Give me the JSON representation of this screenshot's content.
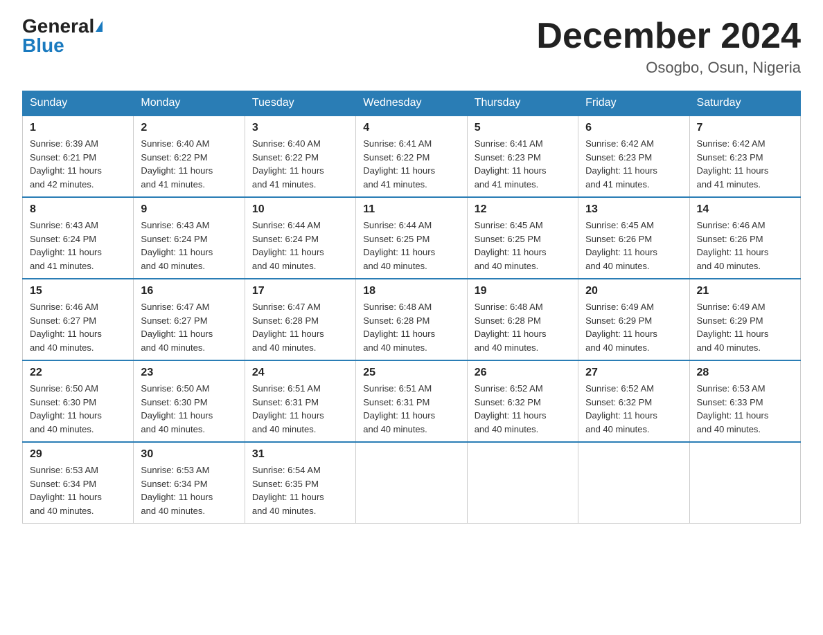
{
  "header": {
    "logo_general": "General",
    "logo_blue": "Blue",
    "month_title": "December 2024",
    "location": "Osogbo, Osun, Nigeria"
  },
  "columns": [
    "Sunday",
    "Monday",
    "Tuesday",
    "Wednesday",
    "Thursday",
    "Friday",
    "Saturday"
  ],
  "weeks": [
    [
      {
        "day": "1",
        "sunrise": "6:39 AM",
        "sunset": "6:21 PM",
        "daylight": "11 hours and 42 minutes."
      },
      {
        "day": "2",
        "sunrise": "6:40 AM",
        "sunset": "6:22 PM",
        "daylight": "11 hours and 41 minutes."
      },
      {
        "day": "3",
        "sunrise": "6:40 AM",
        "sunset": "6:22 PM",
        "daylight": "11 hours and 41 minutes."
      },
      {
        "day": "4",
        "sunrise": "6:41 AM",
        "sunset": "6:22 PM",
        "daylight": "11 hours and 41 minutes."
      },
      {
        "day": "5",
        "sunrise": "6:41 AM",
        "sunset": "6:23 PM",
        "daylight": "11 hours and 41 minutes."
      },
      {
        "day": "6",
        "sunrise": "6:42 AM",
        "sunset": "6:23 PM",
        "daylight": "11 hours and 41 minutes."
      },
      {
        "day": "7",
        "sunrise": "6:42 AM",
        "sunset": "6:23 PM",
        "daylight": "11 hours and 41 minutes."
      }
    ],
    [
      {
        "day": "8",
        "sunrise": "6:43 AM",
        "sunset": "6:24 PM",
        "daylight": "11 hours and 41 minutes."
      },
      {
        "day": "9",
        "sunrise": "6:43 AM",
        "sunset": "6:24 PM",
        "daylight": "11 hours and 40 minutes."
      },
      {
        "day": "10",
        "sunrise": "6:44 AM",
        "sunset": "6:24 PM",
        "daylight": "11 hours and 40 minutes."
      },
      {
        "day": "11",
        "sunrise": "6:44 AM",
        "sunset": "6:25 PM",
        "daylight": "11 hours and 40 minutes."
      },
      {
        "day": "12",
        "sunrise": "6:45 AM",
        "sunset": "6:25 PM",
        "daylight": "11 hours and 40 minutes."
      },
      {
        "day": "13",
        "sunrise": "6:45 AM",
        "sunset": "6:26 PM",
        "daylight": "11 hours and 40 minutes."
      },
      {
        "day": "14",
        "sunrise": "6:46 AM",
        "sunset": "6:26 PM",
        "daylight": "11 hours and 40 minutes."
      }
    ],
    [
      {
        "day": "15",
        "sunrise": "6:46 AM",
        "sunset": "6:27 PM",
        "daylight": "11 hours and 40 minutes."
      },
      {
        "day": "16",
        "sunrise": "6:47 AM",
        "sunset": "6:27 PM",
        "daylight": "11 hours and 40 minutes."
      },
      {
        "day": "17",
        "sunrise": "6:47 AM",
        "sunset": "6:28 PM",
        "daylight": "11 hours and 40 minutes."
      },
      {
        "day": "18",
        "sunrise": "6:48 AM",
        "sunset": "6:28 PM",
        "daylight": "11 hours and 40 minutes."
      },
      {
        "day": "19",
        "sunrise": "6:48 AM",
        "sunset": "6:28 PM",
        "daylight": "11 hours and 40 minutes."
      },
      {
        "day": "20",
        "sunrise": "6:49 AM",
        "sunset": "6:29 PM",
        "daylight": "11 hours and 40 minutes."
      },
      {
        "day": "21",
        "sunrise": "6:49 AM",
        "sunset": "6:29 PM",
        "daylight": "11 hours and 40 minutes."
      }
    ],
    [
      {
        "day": "22",
        "sunrise": "6:50 AM",
        "sunset": "6:30 PM",
        "daylight": "11 hours and 40 minutes."
      },
      {
        "day": "23",
        "sunrise": "6:50 AM",
        "sunset": "6:30 PM",
        "daylight": "11 hours and 40 minutes."
      },
      {
        "day": "24",
        "sunrise": "6:51 AM",
        "sunset": "6:31 PM",
        "daylight": "11 hours and 40 minutes."
      },
      {
        "day": "25",
        "sunrise": "6:51 AM",
        "sunset": "6:31 PM",
        "daylight": "11 hours and 40 minutes."
      },
      {
        "day": "26",
        "sunrise": "6:52 AM",
        "sunset": "6:32 PM",
        "daylight": "11 hours and 40 minutes."
      },
      {
        "day": "27",
        "sunrise": "6:52 AM",
        "sunset": "6:32 PM",
        "daylight": "11 hours and 40 minutes."
      },
      {
        "day": "28",
        "sunrise": "6:53 AM",
        "sunset": "6:33 PM",
        "daylight": "11 hours and 40 minutes."
      }
    ],
    [
      {
        "day": "29",
        "sunrise": "6:53 AM",
        "sunset": "6:34 PM",
        "daylight": "11 hours and 40 minutes."
      },
      {
        "day": "30",
        "sunrise": "6:53 AM",
        "sunset": "6:34 PM",
        "daylight": "11 hours and 40 minutes."
      },
      {
        "day": "31",
        "sunrise": "6:54 AM",
        "sunset": "6:35 PM",
        "daylight": "11 hours and 40 minutes."
      },
      null,
      null,
      null,
      null
    ]
  ],
  "labels": {
    "sunrise": "Sunrise:",
    "sunset": "Sunset:",
    "daylight": "Daylight:"
  }
}
